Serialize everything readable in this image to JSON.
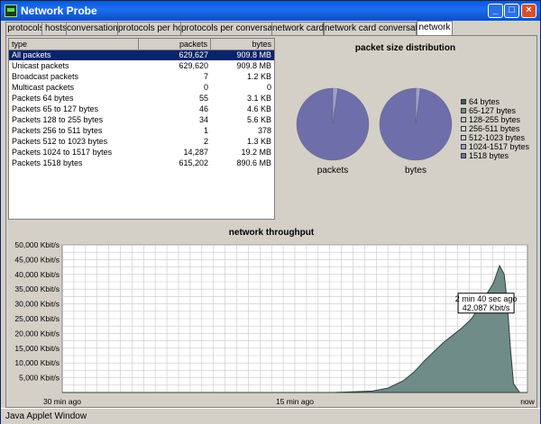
{
  "window": {
    "title": "Network Probe"
  },
  "tabs": [
    {
      "label": "protocols",
      "active": false
    },
    {
      "label": "hosts",
      "active": false
    },
    {
      "label": "conversations",
      "active": false
    },
    {
      "label": "protocols per host",
      "active": false
    },
    {
      "label": "protocols per conversation",
      "active": false
    },
    {
      "label": "network cards",
      "active": false
    },
    {
      "label": "network card conversations",
      "active": false
    },
    {
      "label": "network",
      "active": true
    }
  ],
  "table": {
    "headers": {
      "type": "type",
      "packets": "packets",
      "bytes": "bytes"
    },
    "rows": [
      {
        "type": "All packets",
        "packets": "629,627",
        "bytes": "909.8 MB"
      },
      {
        "type": "Unicast packets",
        "packets": "629,620",
        "bytes": "909.8 MB"
      },
      {
        "type": "Broadcast packets",
        "packets": "7",
        "bytes": "1.2 KB"
      },
      {
        "type": "Multicast packets",
        "packets": "0",
        "bytes": "0"
      },
      {
        "type": "Packets 64 bytes",
        "packets": "55",
        "bytes": "3.1 KB"
      },
      {
        "type": "Packets 65 to 127 bytes",
        "packets": "46",
        "bytes": "4.6 KB"
      },
      {
        "type": "Packets 128 to 255 bytes",
        "packets": "34",
        "bytes": "5.6 KB"
      },
      {
        "type": "Packets 256 to 511 bytes",
        "packets": "1",
        "bytes": "378"
      },
      {
        "type": "Packets 512 to 1023 bytes",
        "packets": "2",
        "bytes": "1.3 KB"
      },
      {
        "type": "Packets 1024 to 1517 bytes",
        "packets": "14,287",
        "bytes": "19.2 MB"
      },
      {
        "type": "Packets 1518 bytes",
        "packets": "615,202",
        "bytes": "890.6 MB"
      }
    ]
  },
  "pie": {
    "title": "packet size distribution",
    "labels": {
      "packets": "packets",
      "bytes": "bytes"
    },
    "legend": [
      {
        "label": "64 bytes",
        "color": "#3f5f5f"
      },
      {
        "label": "65-127 bytes",
        "color": "#6a9a8a"
      },
      {
        "label": "128-255 bytes",
        "color": "#b8cfc8"
      },
      {
        "label": "256-511 bytes",
        "color": "#d8d8e8"
      },
      {
        "label": "512-1023 bytes",
        "color": "#c8c8e0"
      },
      {
        "label": "1024-1517 bytes",
        "color": "#9ea0d0"
      },
      {
        "label": "1518 bytes",
        "color": "#6e6eaa"
      }
    ]
  },
  "chart_data": [
    {
      "type": "pie",
      "name": "packets",
      "categories": [
        "64 bytes",
        "65-127 bytes",
        "128-255 bytes",
        "256-511 bytes",
        "512-1023 bytes",
        "1024-1517 bytes",
        "1518 bytes"
      ],
      "values": [
        55,
        46,
        34,
        1,
        2,
        14287,
        615202
      ]
    },
    {
      "type": "pie",
      "name": "bytes",
      "categories": [
        "64 bytes",
        "65-127 bytes",
        "128-255 bytes",
        "256-511 bytes",
        "512-1023 bytes",
        "1024-1517 bytes",
        "1518 bytes"
      ],
      "values": [
        3.1,
        4.6,
        5.6,
        0.369,
        1.3,
        19660.8,
        911974.4
      ]
    },
    {
      "type": "area",
      "title": "network throughput",
      "ylabel_unit": "Kbit/s",
      "ylim": [
        0,
        50000
      ],
      "yticks": [
        "50,000 Kbit/s",
        "45,000 Kbit/s",
        "40,000 Kbit/s",
        "35,000 Kbit/s",
        "30,000 Kbit/s",
        "25,000 Kbit/s",
        "20,000 Kbit/s",
        "15,000 Kbit/s",
        "10,000 Kbit/s",
        "5,000 Kbit/s"
      ],
      "xticks": [
        "30 min ago",
        "15 min ago",
        "now"
      ],
      "xlim": [
        30,
        0
      ],
      "grid": true,
      "x": [
        30,
        20,
        12.5,
        10,
        9,
        8,
        7.3,
        6.6,
        6,
        5.4,
        4.8,
        4.2,
        3.6,
        3.0,
        2.67,
        2.2,
        1.8,
        1.5,
        1.3,
        1.1,
        0.9,
        0.5,
        0
      ],
      "values": [
        0,
        0,
        0,
        500,
        1500,
        4000,
        7000,
        11000,
        14000,
        17000,
        19500,
        22000,
        25000,
        30000,
        33000,
        37000,
        43000,
        40000,
        30000,
        15000,
        3000,
        0,
        0
      ],
      "tooltip": {
        "time": "2 min 40 sec ago",
        "value": "42,087 Kbit/s"
      }
    }
  ],
  "status": {
    "text": "Java Applet Window"
  }
}
